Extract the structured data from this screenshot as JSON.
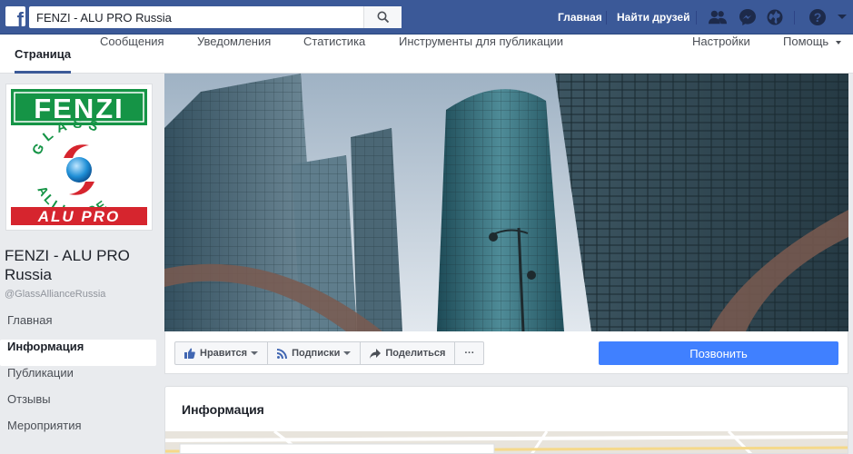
{
  "topbar": {
    "search_value": "FENZI - ALU PRO Russia",
    "home_label": "Главная",
    "find_friends_label": "Найти друзей",
    "brand_color": "#3b5998",
    "icons": [
      "friend-requests-icon",
      "messenger-icon",
      "notifications-globe-icon",
      "help-icon",
      "account-menu-caret-icon"
    ]
  },
  "subnav": {
    "tabs": [
      {
        "label": "Страница",
        "active": true
      },
      {
        "label": "Сообщения"
      },
      {
        "label": "Уведомления"
      },
      {
        "label": "Статистика"
      },
      {
        "label": "Инструменты для публикации"
      }
    ],
    "settings_label": "Настройки",
    "help_label": "Помощь"
  },
  "profile": {
    "logo_top": "FENZI",
    "logo_ring": "GLASS ALLIANCE",
    "logo_bottom": "ALU PRO",
    "name": "FENZI - ALU PRO Russia",
    "handle": "@GlassAllianceRussia"
  },
  "leftnav": {
    "items": [
      {
        "label": "Главная"
      },
      {
        "label": "Информация",
        "active": true
      },
      {
        "label": "Публикации"
      },
      {
        "label": "Отзывы"
      },
      {
        "label": "Мероприятия"
      }
    ]
  },
  "actions": {
    "like_label": "Нравится",
    "follow_label": "Подписки",
    "share_label": "Поделиться",
    "more_label": "···",
    "call_label": "Позвонить",
    "call_color": "#4080ff"
  },
  "info": {
    "title": "Информация"
  }
}
